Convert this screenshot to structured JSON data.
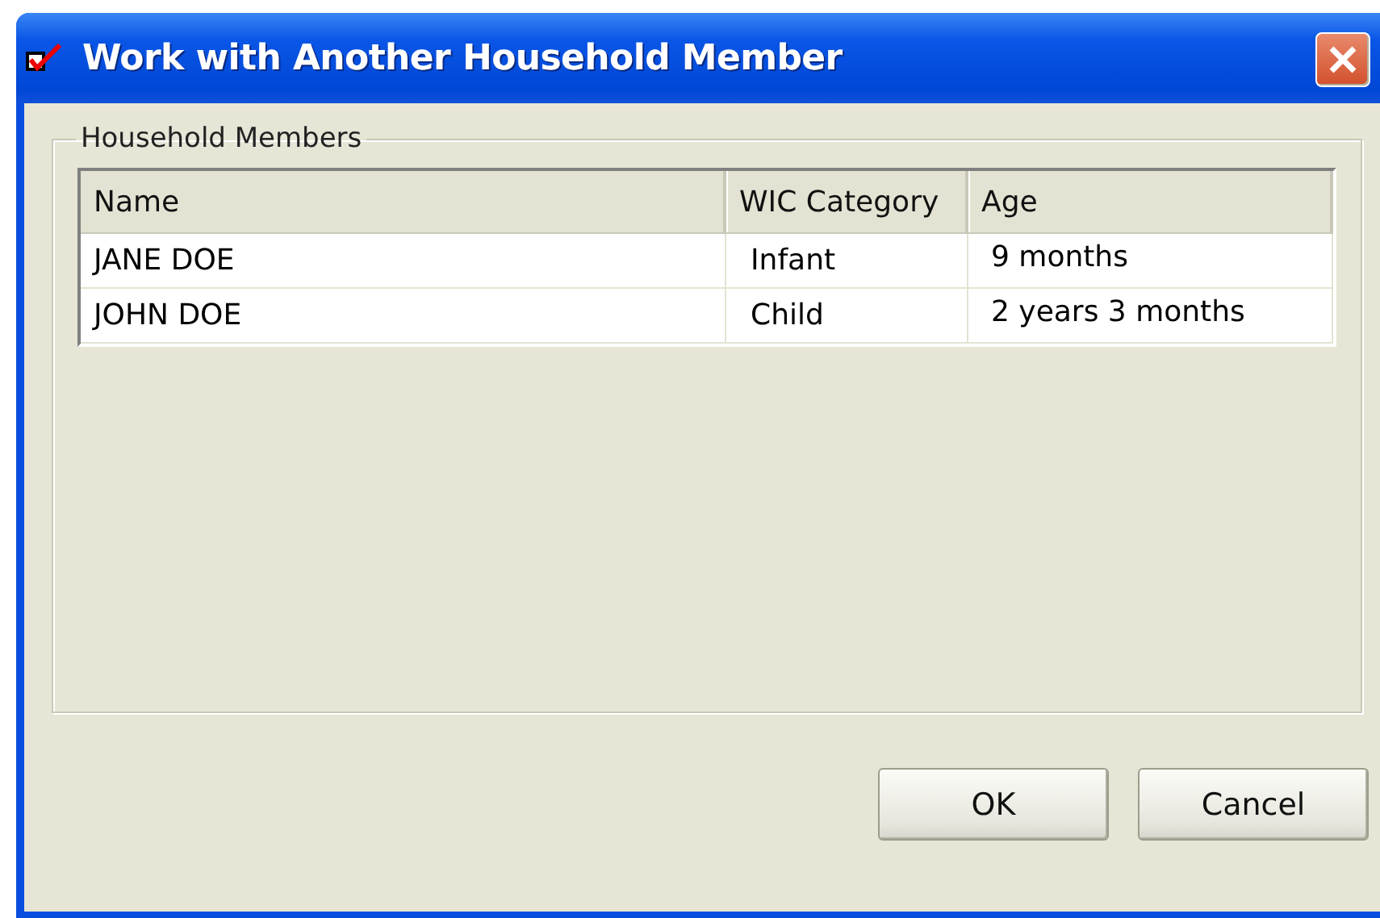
{
  "window": {
    "title": "Work with Another Household Member"
  },
  "group": {
    "label": "Household Members"
  },
  "table": {
    "columns": [
      "Name",
      "WIC Category",
      "Age"
    ],
    "rows": [
      [
        "JANE DOE",
        "Infant",
        "9 months"
      ],
      [
        "JOHN DOE",
        "Child",
        "2 years 3 months"
      ]
    ]
  },
  "buttons": [
    "OK",
    "Cancel"
  ]
}
